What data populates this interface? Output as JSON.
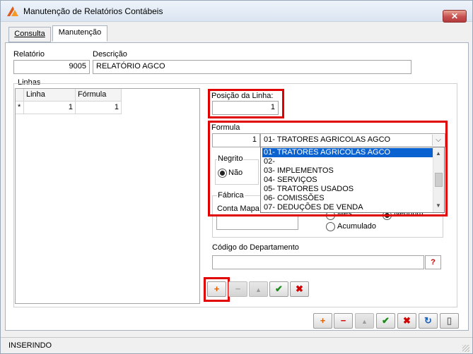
{
  "window": {
    "title": "Manutenção de Relatórios Contábeis",
    "close_symbol": "✕"
  },
  "tabs": [
    {
      "label": "Consulta"
    },
    {
      "label": "Manutenção"
    }
  ],
  "header": {
    "relatorio_label": "Relatório",
    "relatorio_value": "9005",
    "descricao_label": "Descrição",
    "descricao_value": "RELATÓRIO AGCO"
  },
  "linhas": {
    "group_label": "Linhas",
    "columns": [
      "Linha",
      "Fórmula"
    ],
    "rows": [
      {
        "marker": "*",
        "linha": "1",
        "formula": "1"
      }
    ]
  },
  "posicao": {
    "label": "Posição da Linha:",
    "value": "1"
  },
  "formula": {
    "group_label": "Formula",
    "code_value": "1",
    "selected_text": "01- TRATORES AGRICOLAS AGCO",
    "options": [
      "01- TRATORES AGRICOLAS AGCO",
      "02-",
      "03- IMPLEMENTOS",
      "04- SERVIÇOS",
      "05- TRATORES USADOS",
      "06- COMISSÕES",
      "07- DEDUÇÕES DE VENDA"
    ]
  },
  "negrito": {
    "label": "Negrito",
    "option_nao": "Não"
  },
  "fabrica": {
    "label": "Fábrica",
    "conta_mapa_label": "Conta Mapa"
  },
  "periodo": {
    "mes_label": "Mês",
    "nenhum_label": "Nenhum",
    "acumulado_label": "Acumulado"
  },
  "departamento": {
    "label": "Código do Departamento",
    "value": "",
    "lookup_glyph": "?"
  },
  "status": {
    "text": "INSERINDO"
  },
  "icons": {
    "plus": "+",
    "minus": "−",
    "up": "▲",
    "check": "✔",
    "cross": "✖",
    "refresh": "↻",
    "exit": "▯"
  },
  "colors": {
    "highlight_red": "#e00000",
    "selection_blue": "#0a62d0"
  }
}
